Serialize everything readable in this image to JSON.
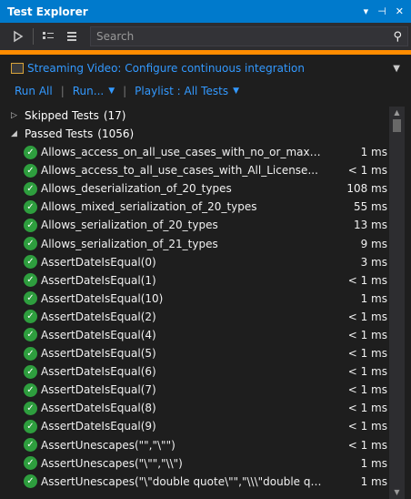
{
  "window": {
    "title": "Test Explorer",
    "title_bar_icons": [
      "dropdown-icon",
      "pin-icon",
      "close-icon"
    ]
  },
  "toolbar": {
    "buttons": [
      "run-icon",
      "group-by-icon",
      "playlist-icon"
    ],
    "search_placeholder": "Search"
  },
  "playlist": {
    "name": "Streaming Video: Configure continuous integration"
  },
  "actions": {
    "run_all": "Run All",
    "run": "Run...",
    "playlist": "Playlist : All Tests"
  },
  "groups": {
    "skipped": {
      "name": "Skipped Tests",
      "count": "(17)"
    },
    "passed": {
      "name": "Passed Tests",
      "count": "(1056)"
    }
  },
  "tests": [
    {
      "name": "Allows_access_on_all_use_cases_with_no_or_max_allowed_u...",
      "duration": "1 ms"
    },
    {
      "name": "Allows_access_to_all_use_cases_with_All_License...",
      "duration": "< 1 ms"
    },
    {
      "name": "Allows_deserialization_of_20_types",
      "duration": "108 ms"
    },
    {
      "name": "Allows_mixed_serialization_of_20_types",
      "duration": "55 ms"
    },
    {
      "name": "Allows_serialization_of_20_types",
      "duration": "13 ms"
    },
    {
      "name": "Allows_serialization_of_21_types",
      "duration": "9 ms"
    },
    {
      "name": "AssertDateIsEqual(0)",
      "duration": "3 ms"
    },
    {
      "name": "AssertDateIsEqual(1)",
      "duration": "< 1 ms"
    },
    {
      "name": "AssertDateIsEqual(10)",
      "duration": "1 ms"
    },
    {
      "name": "AssertDateIsEqual(2)",
      "duration": "< 1 ms"
    },
    {
      "name": "AssertDateIsEqual(4)",
      "duration": "< 1 ms"
    },
    {
      "name": "AssertDateIsEqual(5)",
      "duration": "< 1 ms"
    },
    {
      "name": "AssertDateIsEqual(6)",
      "duration": "< 1 ms"
    },
    {
      "name": "AssertDateIsEqual(7)",
      "duration": "< 1 ms"
    },
    {
      "name": "AssertDateIsEqual(8)",
      "duration": "< 1 ms"
    },
    {
      "name": "AssertDateIsEqual(9)",
      "duration": "< 1 ms"
    },
    {
      "name": "AssertUnescapes(\"\",\"\\\"\")",
      "duration": "< 1 ms"
    },
    {
      "name": "AssertUnescapes(\"\\\"\",\"\\\\\")",
      "duration": "1 ms"
    },
    {
      "name": "AssertUnescapes(\"\\\"double quote\\\"\",\"\\\\\\\"double quote\\\\\\\"\")",
      "duration": "1 ms"
    }
  ],
  "colors": {
    "accent": "#007acc",
    "highlight": "#ff8c00",
    "link": "#3399ff",
    "pass": "#2e9e3e"
  }
}
